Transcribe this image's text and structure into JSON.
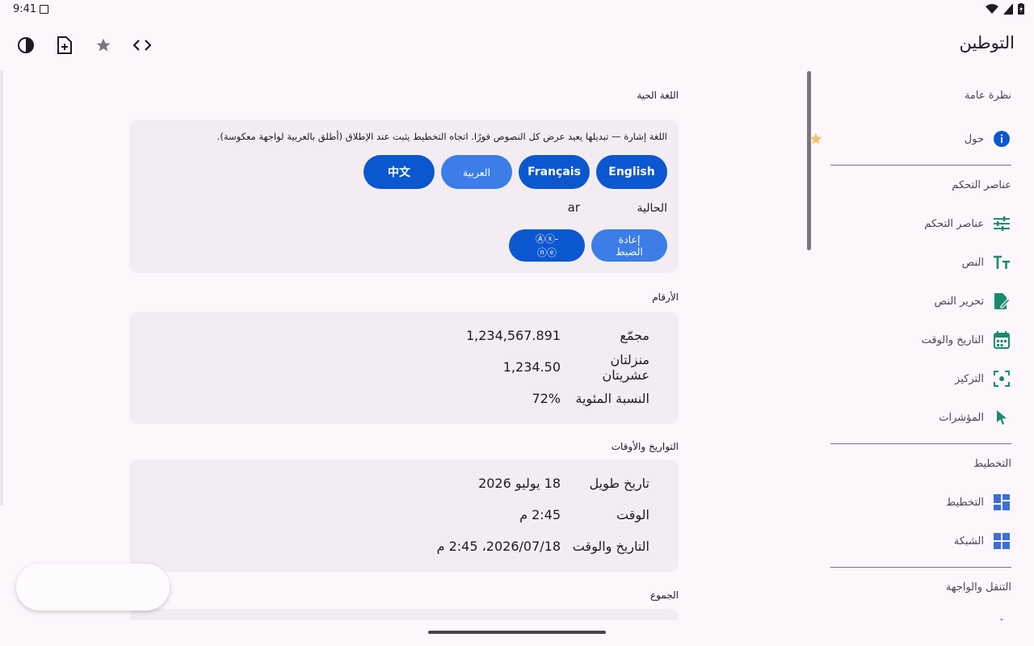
{
  "status": {
    "time": "9:41"
  },
  "app": {
    "title": "التوطين"
  },
  "nav": {
    "sections": [
      {
        "label": "نظرة عامة",
        "items": [
          {
            "label": "حول",
            "icon": "info-icon"
          }
        ]
      },
      {
        "label": "عناصر التحكم",
        "items": [
          {
            "label": "عناصر التحكم",
            "icon": "sliders-icon"
          },
          {
            "label": "النص",
            "icon": "text-icon"
          },
          {
            "label": "تحرير النص",
            "icon": "edit-doc-icon"
          },
          {
            "label": "التاريخ والوقت",
            "icon": "calendar-icon"
          },
          {
            "label": "التركيز",
            "icon": "focus-icon"
          },
          {
            "label": "المؤشرات",
            "icon": "pointer-icon"
          }
        ]
      },
      {
        "label": "التخطيط",
        "items": [
          {
            "label": "التخطيط",
            "icon": "layout-icon"
          },
          {
            "label": "الشبكة",
            "icon": "grid-icon"
          }
        ]
      },
      {
        "label": "التنقل والواجهة",
        "items": []
      }
    ]
  },
  "live_language": {
    "label": "اللغة الحية",
    "description": "اللغة إشارة — تبديلها يعيد عرض كل النصوص فورًا. اتجاه التخطيط يثبت عند الإطلاق (أطلق بالعربية لواجهة معكوسة).",
    "languages": [
      "English",
      "Français",
      "العربية",
      "中文"
    ],
    "current_label": "الحالية",
    "current_value": "ar",
    "reset_label": "إعادة الضبط",
    "pseudo_label": "Ⓐⓧ-ⓝⓔ"
  },
  "numbers": {
    "label": "الأرقام",
    "rows": [
      {
        "key": "مجمّع",
        "value": "1,234,567.891"
      },
      {
        "key": "منزلتان عشريتان",
        "value": "1,234.50"
      },
      {
        "key": "النسبة المئوية",
        "value": "72%"
      }
    ]
  },
  "dates": {
    "label": "التواريخ والأوقات",
    "rows": [
      {
        "key": "تاريخ طويل",
        "value": "18 يوليو 2026"
      },
      {
        "key": "الوقت",
        "value": "2:45 م"
      },
      {
        "key": "التاريخ والوقت",
        "value": "2026/07/18، 2:45 م"
      }
    ]
  },
  "plurals": {
    "label": "الجموع"
  },
  "colors": {
    "accent": "#0b57d0",
    "nav_icon_green": "#1a8a6e",
    "nav_icon_blue": "#3b6fd8"
  }
}
